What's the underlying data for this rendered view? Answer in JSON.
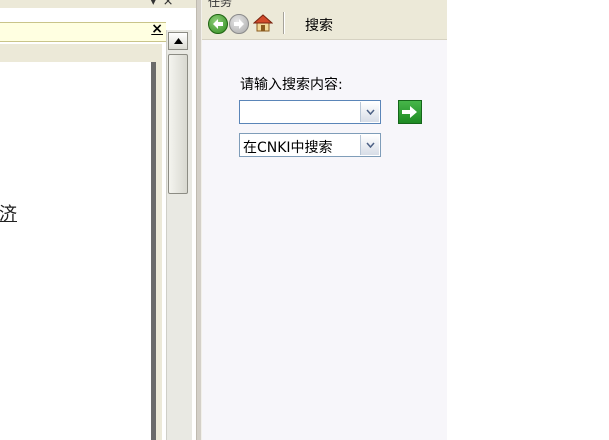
{
  "task_pane": {
    "title": "任务",
    "toolbar_title": "搜索",
    "search_prompt": "请输入搜索内容:",
    "search_value": "",
    "source_selected": "在CNKI中搜索"
  },
  "document": {
    "partial_text": "济",
    "infobar_close": "×"
  },
  "pane_controls": "▾ ×",
  "icons": {
    "back": "back-arrow-icon",
    "forward": "forward-arrow-icon",
    "home": "home-icon",
    "go": "go-arrow-icon",
    "dropdown": "chevron-down-icon",
    "scroll_up": "scroll-up-arrow-icon"
  },
  "colors": {
    "go_button": "#2a9b2e",
    "task_pane_bg": "#f7f6fa",
    "infobar_bg": "#ffffe1"
  }
}
